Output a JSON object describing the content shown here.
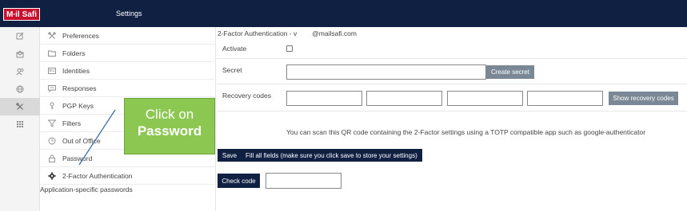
{
  "topbar": {
    "logo_part1": "M∙il",
    "logo_part2": "Safi",
    "title": "Settings"
  },
  "iconbar": [
    {
      "icon": "compose-icon",
      "active": false
    },
    {
      "icon": "mail-icon",
      "active": false
    },
    {
      "icon": "contacts-icon",
      "active": false
    },
    {
      "icon": "globe-icon",
      "active": false
    },
    {
      "icon": "settings-tools-icon",
      "active": true
    },
    {
      "icon": "apps-grid-icon",
      "active": false
    }
  ],
  "settings_menu": {
    "items": [
      {
        "label": "Preferences",
        "icon": "tools-icon"
      },
      {
        "label": "Folders",
        "icon": "folder-icon"
      },
      {
        "label": "Identities",
        "icon": "id-card-icon"
      },
      {
        "label": "Responses",
        "icon": "message-icon"
      },
      {
        "label": "PGP Keys",
        "icon": "key-icon"
      },
      {
        "label": "Filters",
        "icon": "filter-icon"
      },
      {
        "label": "Out of Office",
        "icon": "clock-icon"
      },
      {
        "label": "Password",
        "icon": "lock-icon"
      },
      {
        "label": "2-Factor Authentication",
        "icon": "gear-icon"
      }
    ],
    "extra_label": "Application-specific passwords"
  },
  "twofa": {
    "header_prefix": "2-Factor Authentication - v",
    "header_email": "@mailsafi.com",
    "activate_label": "Activate",
    "secret_label": "Secret",
    "create_secret_button": "Create secret",
    "recovery_label": "Recovery codes",
    "show_recovery_button": "Show recovery codes",
    "qr_note": "You can scan this QR code containing the 2-Factor settings using a TOTP compatible app such as google-authenticator",
    "save_button": "Save",
    "save_tooltip": "Fill all fields (make sure you click save to store your settings)",
    "check_code_button": "Check code"
  },
  "callout": {
    "line1": "Click on",
    "line2": "Password"
  },
  "colors": {
    "topbar": "#0f2043",
    "callout": "#8cc751",
    "button_gray": "#7a8794",
    "logo_red": "#c8102e"
  }
}
